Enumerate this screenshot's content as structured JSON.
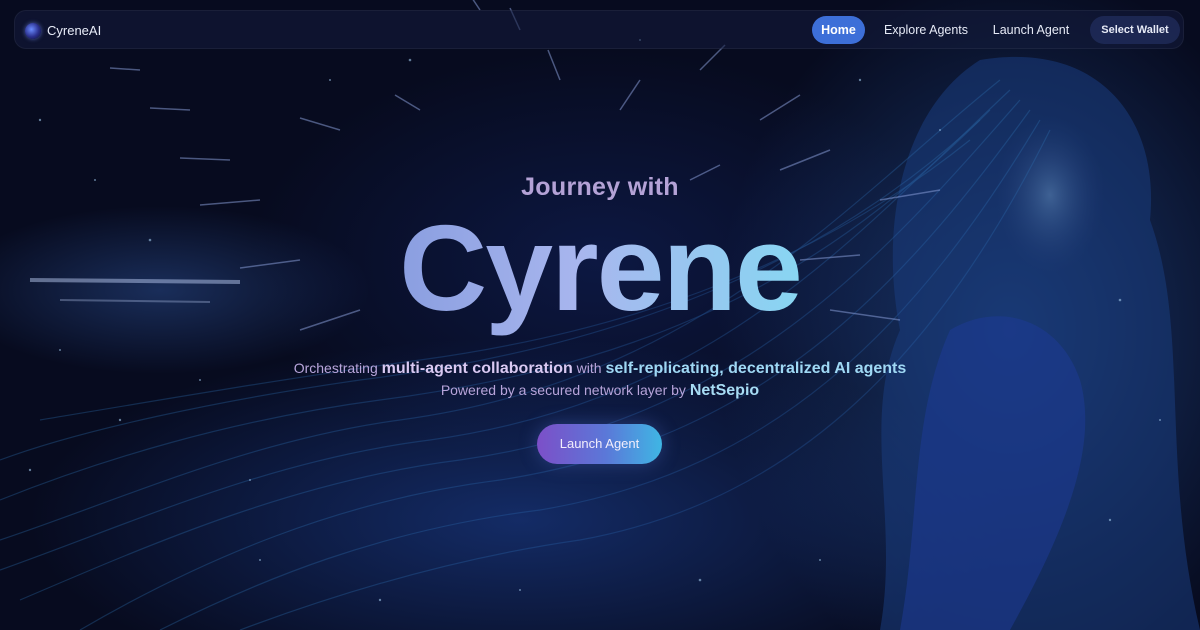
{
  "nav": {
    "brand": "CyreneAI",
    "brand_icon": "cyrene-logo-icon",
    "items": [
      {
        "label": "Home",
        "active": true
      },
      {
        "label": "Explore Agents",
        "active": false
      },
      {
        "label": "Launch Agent",
        "active": false
      }
    ],
    "wallet_button": "Select Wallet"
  },
  "hero": {
    "subtitle": "Journey with",
    "title": "Cyrene",
    "tagline": {
      "t1": "Orchestrating ",
      "b1": "multi-agent collaboration",
      "t2": " with ",
      "b2": "self-replicating, decentralized AI agents"
    },
    "powered": {
      "text": "Powered by a secured network layer by ",
      "brand": "NetSepio"
    },
    "cta": "Launch Agent"
  },
  "colors": {
    "background": "#070b1f",
    "active_nav": "#3d6fd8",
    "cta_start": "#7c4fc8",
    "cta_end": "#3fb6e4"
  }
}
